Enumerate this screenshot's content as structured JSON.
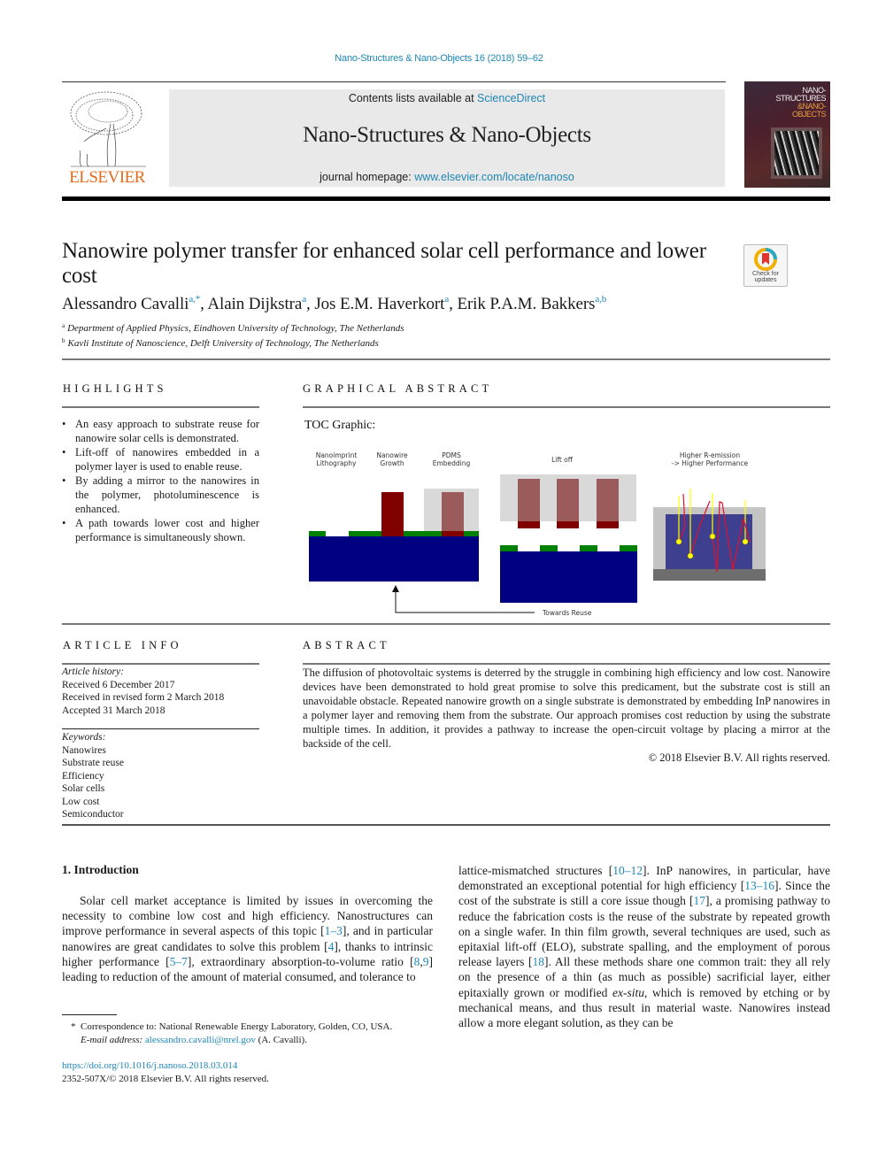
{
  "header": {
    "journal_ref": "Nano-Structures & Nano-Objects 16 (2018) 59–62",
    "contents_prefix": "Contents lists available at ",
    "contents_link": "ScienceDirect",
    "journal_name": "Nano-Structures & Nano-Objects",
    "homepage_prefix": "journal homepage: ",
    "homepage_link": "www.elsevier.com/locate/nanoso",
    "publisher_logo": "ELSEVIER",
    "cover_title": [
      "NANO-",
      "STRUCTURES",
      "&NANO-",
      "OBJECTS"
    ],
    "check_updates_label_1": "Check for",
    "check_updates_label_2": "updates"
  },
  "article": {
    "title": "Nanowire polymer transfer for enhanced solar cell performance and lower cost",
    "authors": [
      {
        "name": "Alessandro Cavalli",
        "sup": "a,*",
        "sep": ", "
      },
      {
        "name": "Alain Dijkstra",
        "sup": "a",
        "sep": ", "
      },
      {
        "name": "Jos E.M. Haverkort",
        "sup": "a",
        "sep": ", "
      },
      {
        "name": "Erik P.A.M. Bakkers",
        "sup": "a,b",
        "sep": ""
      }
    ],
    "affiliations": [
      {
        "mark": "a",
        "text": "Department of Applied Physics, Eindhoven University of Technology, The Netherlands"
      },
      {
        "mark": "b",
        "text": "Kavli Institute of Nanoscience, Delft University of Technology, The Netherlands"
      }
    ]
  },
  "highlights": {
    "heading": "HIGHLIGHTS",
    "items": [
      "An easy approach to substrate reuse for nanowire solar cells is demonstrated.",
      "Lift-off of nanowires embedded in a polymer layer is used to enable reuse.",
      "By adding a mirror to the nanowires in the polymer, photoluminescence is enhanced.",
      "A path towards lower cost and higher performance is simultaneously shown."
    ]
  },
  "graphical_abstract": {
    "heading": "GRAPHICAL ABSTRACT",
    "toc_label": "TOC Graphic:",
    "steps": {
      "nanoimprint": [
        "Nanoimprint",
        "Lithography"
      ],
      "growth": [
        "Nanowire",
        "Growth"
      ],
      "pdms": [
        "PDMS",
        "Embedding"
      ],
      "liftoff": [
        "Lift off"
      ],
      "emission": [
        "Higher R-emission",
        "-> Higher Performance"
      ]
    },
    "reuse_label": "Towards Reuse",
    "colors": {
      "substrate": "#000080",
      "mask": "#008000",
      "nanowire": "#800000",
      "nanowire_embedded": "#9b5b5b",
      "pdms": "#d9d9d9",
      "mirror": "#6e6e6e",
      "emission_polymer": "#3f3f8f",
      "emission_ray_yellow": "#ffff00",
      "emission_ray_red": "#e0102c"
    }
  },
  "article_info": {
    "heading": "ARTICLE INFO",
    "history_label": "Article history:",
    "history": [
      "Received 6 December 2017",
      "Received in revised form 2 March 2018",
      "Accepted 31 March 2018"
    ],
    "keywords_label": "Keywords:",
    "keywords": [
      "Nanowires",
      "Substrate reuse",
      "Efficiency",
      "Solar cells",
      "Low cost",
      "Semiconductor"
    ]
  },
  "abstract": {
    "heading": "ABSTRACT",
    "text": "The diffusion of photovoltaic systems is deterred by the struggle in combining high efficiency and low cost. Nanowire devices have been demonstrated to hold great promise to solve this predicament, but the substrate cost is still an unavoidable obstacle. Repeated nanowire growth on a single substrate is demonstrated by embedding InP nanowires in a polymer layer and removing them from the substrate. Our approach promises cost reduction by using the substrate multiple times. In addition, it provides a pathway to increase the open-circuit voltage by placing a mirror at the backside of the cell.",
    "copyright": "© 2018 Elsevier B.V. All rights reserved."
  },
  "introduction": {
    "heading": "1.  Introduction",
    "col1": [
      {
        "t": "Solar cell market acceptance is limited by issues in overcoming the necessity to combine low cost and high efficiency. Nanostructures can improve performance in several aspects of this topic "
      },
      {
        "t": "[",
        "plain": true
      },
      {
        "t": "1–3",
        "ref": true
      },
      {
        "t": "], and in particular nanowires are great candidates to solve this problem ["
      },
      {
        "t": "4",
        "ref": true
      },
      {
        "t": "], thanks to intrinsic higher performance ["
      },
      {
        "t": "5–7",
        "ref": true
      },
      {
        "t": "], extraordinary absorption-to-volume ratio ["
      },
      {
        "t": "8",
        "ref": true
      },
      {
        "t": ","
      },
      {
        "t": "9",
        "ref": true
      },
      {
        "t": "] leading to reduction of the amount of material consumed, and tolerance to"
      }
    ],
    "col2": [
      {
        "t": "lattice-mismatched structures ["
      },
      {
        "t": "10–12",
        "ref": true
      },
      {
        "t": "]. InP nanowires, in particular, have demonstrated an exceptional potential for high efficiency ["
      },
      {
        "t": "13–16",
        "ref": true
      },
      {
        "t": "]. Since the cost of the substrate is still a core issue though ["
      },
      {
        "t": "17",
        "ref": true
      },
      {
        "t": "], a promising pathway to reduce the fabrication costs is the reuse of the substrate by repeated growth on a single wafer. In thin film growth, several techniques are used, such as epitaxial lift-off (ELO), substrate spalling, and the employment of porous release layers ["
      },
      {
        "t": "18",
        "ref": true
      },
      {
        "t": "]. All these methods share one common trait: they all rely on the presence of a thin (as much as possible) sacrificial layer, either epitaxially grown or modified "
      },
      {
        "t": "ex-situ",
        "ital": true
      },
      {
        "t": ", which is removed by etching or by mechanical means, and thus result in material waste. Nanowires instead allow a more elegant solution, as they can be"
      }
    ]
  },
  "footnote": {
    "star": "*",
    "correspondence": "Correspondence to: National Renewable Energy Laboratory, Golden, CO, USA.",
    "email_label": "E-mail address:",
    "email": "alessandro.cavalli@nrel.gov",
    "email_suffix": " (A. Cavalli).",
    "doi": "https://doi.org/10.1016/j.nanoso.2018.03.014",
    "issn_line": "2352-507X/© 2018 Elsevier B.V. All rights reserved."
  }
}
